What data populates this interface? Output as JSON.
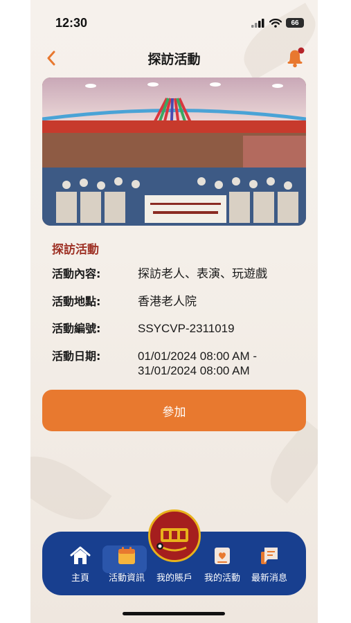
{
  "status_bar": {
    "time": "12:30",
    "battery": "66"
  },
  "header": {
    "title": "探訪活動"
  },
  "event": {
    "section_title": "探訪活動",
    "fields": [
      {
        "label": "活動內容:",
        "value": "探訪老人、表演、玩遊戲"
      },
      {
        "label": "活動地點:",
        "value": "香港老人院"
      },
      {
        "label": "活動編號:",
        "value": "SSYCVP-2311019"
      },
      {
        "label": "活動日期:",
        "value_line1": "01/01/2024 08:00 AM -",
        "value_line2": "31/01/2024 08:00 AM"
      }
    ],
    "join_label": "參加"
  },
  "tabbar": {
    "items": [
      {
        "label": "主頁",
        "icon": "home-icon"
      },
      {
        "label": "活動資訊",
        "icon": "calendar-icon",
        "active": true
      },
      {
        "label": "我的賬戶",
        "icon": "account-icon"
      },
      {
        "label": "我的活動",
        "icon": "my-activity-icon"
      },
      {
        "label": "最新消息",
        "icon": "news-icon"
      }
    ]
  },
  "colors": {
    "accent": "#e8792f",
    "nav": "#183f8f",
    "section_title": "#9e3226"
  }
}
